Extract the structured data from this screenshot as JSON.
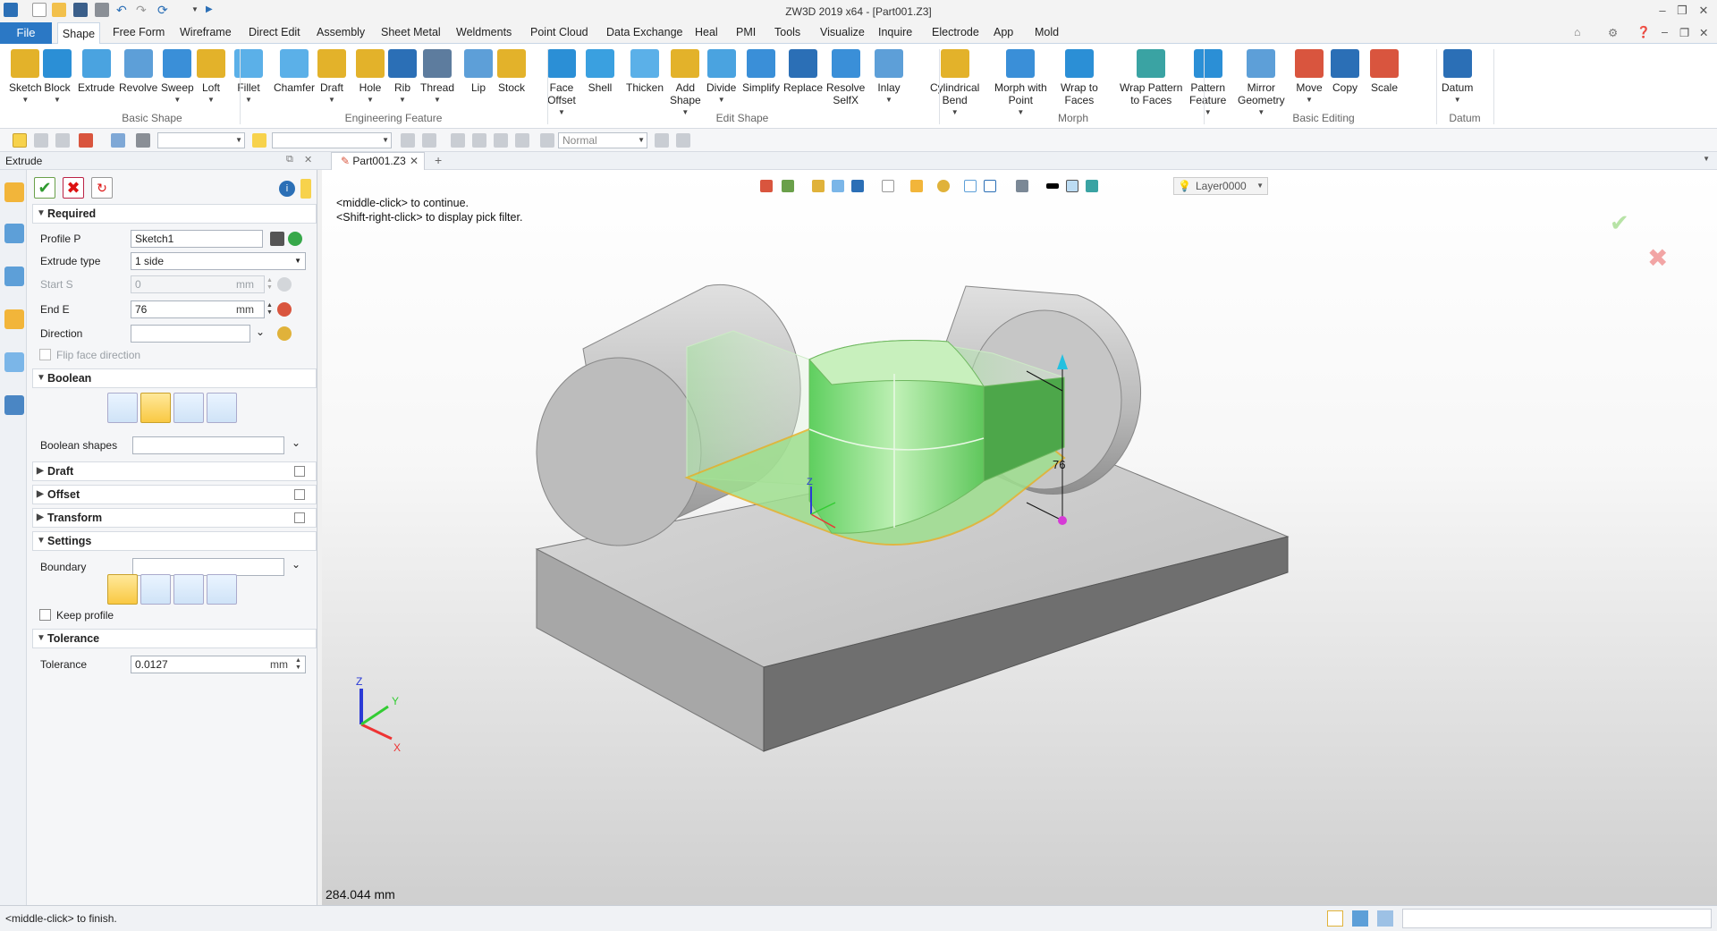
{
  "window": {
    "title": "ZW3D 2019  x64 - [Part001.Z3]"
  },
  "menu": {
    "file": "File",
    "items": [
      "Shape",
      "Free Form",
      "Wireframe",
      "Direct Edit",
      "Assembly",
      "Sheet Metal",
      "Weldments",
      "Point Cloud",
      "Data Exchange",
      "Heal",
      "PMI",
      "Tools",
      "Visualize",
      "Inquire",
      "Electrode",
      "App",
      "Mold"
    ],
    "active": "Shape"
  },
  "ribbon": {
    "buttons": [
      {
        "label": "Sketch",
        "icon": "sketch-icon",
        "dd": true
      },
      {
        "label": "Block",
        "icon": "block-icon",
        "dd": true
      },
      {
        "label": "Extrude",
        "icon": "extrude-icon"
      },
      {
        "label": "Revolve",
        "icon": "revolve-icon"
      },
      {
        "label": "Sweep",
        "icon": "sweep-icon",
        "dd": true
      },
      {
        "label": "Loft",
        "icon": "loft-icon",
        "dd": true
      },
      {
        "label": "Fillet",
        "icon": "fillet-icon",
        "dd": true
      },
      {
        "label": "Chamfer",
        "icon": "chamfer-icon"
      },
      {
        "label": "Draft",
        "icon": "draft-icon",
        "dd": true
      },
      {
        "label": "Hole",
        "icon": "hole-icon",
        "dd": true
      },
      {
        "label": "Rib",
        "icon": "rib-icon",
        "dd": true
      },
      {
        "label": "Thread",
        "icon": "thread-icon",
        "dd": true
      },
      {
        "label": "Lip",
        "icon": "lip-icon"
      },
      {
        "label": "Stock",
        "icon": "stock-icon"
      },
      {
        "label": "Face\nOffset",
        "icon": "face-offset-icon",
        "dd": true
      },
      {
        "label": "Shell",
        "icon": "shell-icon"
      },
      {
        "label": "Thicken",
        "icon": "thicken-icon"
      },
      {
        "label": "Add\nShape",
        "icon": "add-shape-icon",
        "dd": true
      },
      {
        "label": "Divide",
        "icon": "divide-icon",
        "dd": true
      },
      {
        "label": "Simplify",
        "icon": "simplify-icon"
      },
      {
        "label": "Replace",
        "icon": "replace-icon"
      },
      {
        "label": "Resolve\nSelfX",
        "icon": "resolve-selfx-icon"
      },
      {
        "label": "Inlay",
        "icon": "inlay-icon",
        "dd": true
      },
      {
        "label": "Cylindrical\nBend",
        "icon": "cylindrical-bend-icon",
        "dd": true
      },
      {
        "label": "Morph with\nPoint",
        "icon": "morph-point-icon",
        "dd": true
      },
      {
        "label": "Wrap to\nFaces",
        "icon": "wrap-faces-icon"
      },
      {
        "label": "Wrap Pattern\nto Faces",
        "icon": "wrap-pattern-icon"
      },
      {
        "label": "Pattern\nFeature",
        "icon": "pattern-feature-icon",
        "dd": true
      },
      {
        "label": "Mirror\nGeometry",
        "icon": "mirror-geometry-icon",
        "dd": true
      },
      {
        "label": "Move",
        "icon": "move-icon",
        "dd": true
      },
      {
        "label": "Copy",
        "icon": "copy-icon"
      },
      {
        "label": "Scale",
        "icon": "scale-icon"
      },
      {
        "label": "Datum",
        "icon": "datum-icon",
        "dd": true
      }
    ],
    "groups": [
      "Basic Shape",
      "Engineering Feature",
      "Edit Shape",
      "Morph",
      "Basic Editing",
      "Datum"
    ]
  },
  "toolbar2": {
    "filter_value": "",
    "filter2_value": "",
    "mode": "Normal"
  },
  "panel": {
    "title": "Extrude",
    "required": "Required",
    "profile_label": "Profile P",
    "profile_value": "Sketch1",
    "extrude_type_label": "Extrude type",
    "extrude_type_value": "1 side",
    "start_label": "Start S",
    "start_value": "0",
    "end_label": "End E",
    "end_value": "76",
    "unit": "mm",
    "direction_label": "Direction",
    "flip_label": "Flip face direction",
    "boolean": "Boolean",
    "boolean_shapes_label": "Boolean shapes",
    "draft": "Draft",
    "offset": "Offset",
    "transform": "Transform",
    "settings": "Settings",
    "boundary_label": "Boundary",
    "keep_profile_label": "Keep profile",
    "tolerance": "Tolerance",
    "tolerance_label": "Tolerance",
    "tolerance_value": "0.0127"
  },
  "tabs": {
    "doc": "Part001.Z3"
  },
  "viewport": {
    "hint1": "<middle-click> to continue.",
    "hint2": "<Shift-right-click> to display pick filter.",
    "layer": "Layer0000",
    "dim_label": "76",
    "coord_readout": "284.044 mm",
    "axis_x": "X",
    "axis_y": "Y",
    "axis_z": "Z"
  },
  "status": {
    "message": "<middle-click> to finish."
  },
  "colors": {
    "accent": "#2b78c5",
    "extrude_green": "#6fd46a",
    "body_gray": "#c8c8c8"
  }
}
